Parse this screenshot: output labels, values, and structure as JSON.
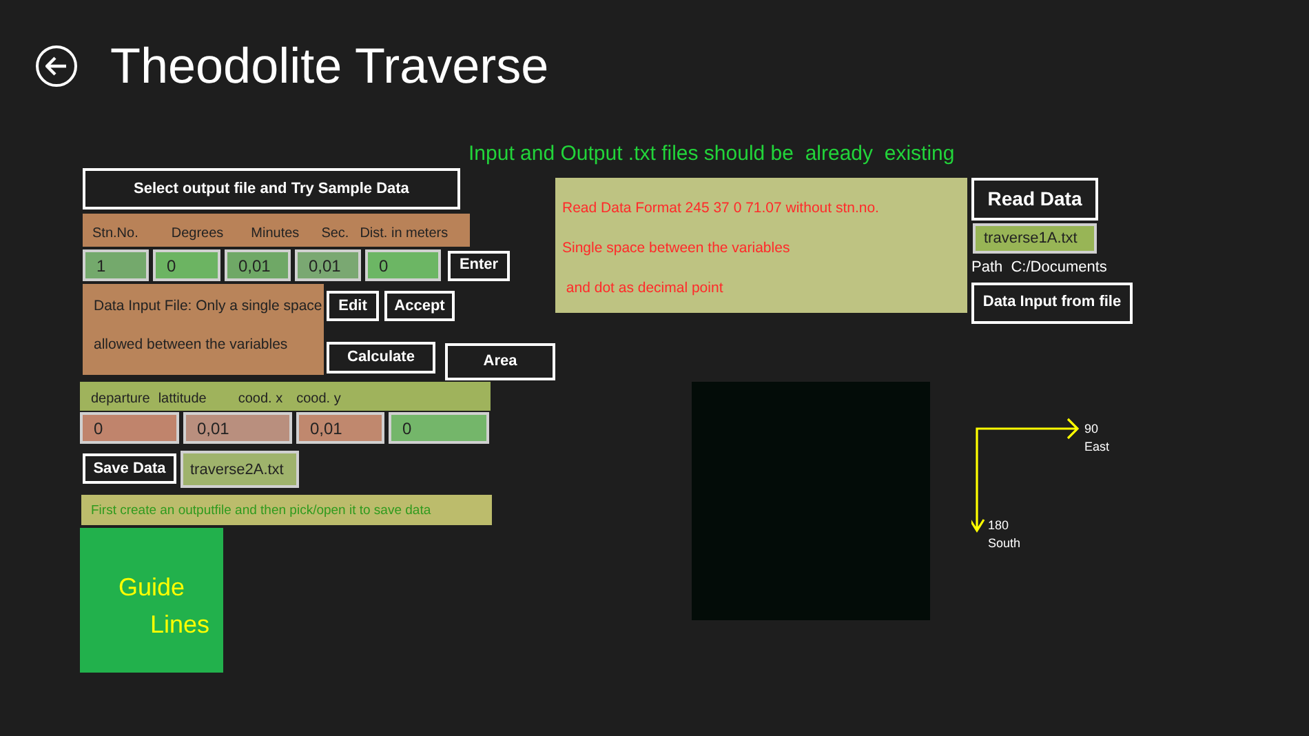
{
  "header": {
    "title": "Theodolite Traverse"
  },
  "notice": "Input and Output .txt files should be  already  existing",
  "select_button": "Select output file and Try Sample Data",
  "input_headers": [
    "Stn.No.",
    "Degrees",
    "Minutes",
    "Sec.",
    "Dist. in meters"
  ],
  "input_fields": [
    {
      "value": "1",
      "color": "#74a96c"
    },
    {
      "value": "0",
      "color": "#6cb462"
    },
    {
      "value": "0,01",
      "color": "#6fa866"
    },
    {
      "value": "0,01",
      "color": "#7aa872"
    },
    {
      "value": "0",
      "color": "#6cb664"
    }
  ],
  "enter_button": "Enter",
  "data_input_file": {
    "lines": [
      "Data Input File: Only a single space",
      "allowed between the variables"
    ]
  },
  "edit_button": "Edit",
  "accept_button": "Accept",
  "calculate_button": "Calculate",
  "area_button": "Area",
  "format_panel": {
    "lines": [
      "Read Data Format 245 37 0 71.07 without stn.no.",
      "Single space between the variables",
      " and dot as decimal point"
    ]
  },
  "read_data_button": "Read Data",
  "input_file": "traverse1A.txt",
  "path": "Path  C:/Documents",
  "data_input_button": "Data Input from file",
  "output_headers": [
    "departure",
    "lattitude",
    "cood. x",
    "cood. y"
  ],
  "output_fields": [
    {
      "value": "0",
      "color": "#c0846c"
    },
    {
      "value": "0,01",
      "color": "#b98f7e"
    },
    {
      "value": "0,01",
      "color": "#c0886e"
    },
    {
      "value": "0",
      "color": "#74b66a"
    }
  ],
  "save_button": "Save Data",
  "output_file": "traverse2A.txt",
  "save_hint": "First create an outputfile and then pick/open it to save data",
  "guide_tile": {
    "line_1": "Guide",
    "line_2": "Lines"
  },
  "compass": {
    "east_value": "90",
    "east_label": "East",
    "south_value": "180",
    "south_label": "South"
  }
}
